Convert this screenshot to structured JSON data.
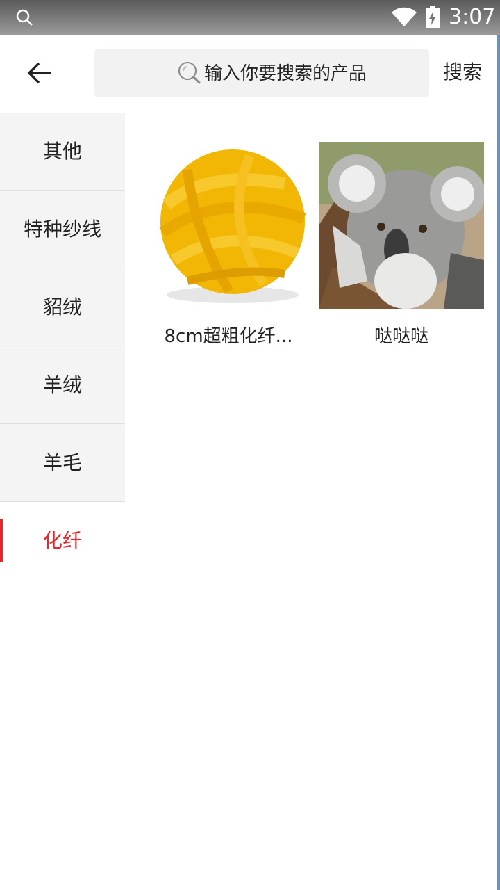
{
  "status_bar": {
    "time": "3:07"
  },
  "header": {
    "search_placeholder": "输入你要搜索的产品",
    "search_button": "搜索"
  },
  "sidebar": {
    "items": [
      {
        "label": "其他",
        "active": false
      },
      {
        "label": "特种纱线",
        "active": false
      },
      {
        "label": "貂绒",
        "active": false
      },
      {
        "label": "羊绒",
        "active": false
      },
      {
        "label": "羊毛",
        "active": false
      },
      {
        "label": "化纤",
        "active": true
      }
    ]
  },
  "products": [
    {
      "name": "8cm超粗化纤...",
      "image": "yellow-yarn-ball"
    },
    {
      "name": "哒哒哒",
      "image": "koala-photo"
    }
  ],
  "colors": {
    "accent": "#e8262a",
    "sidebar_bg": "#f4f4f4",
    "search_bg": "#f2f2f2"
  }
}
